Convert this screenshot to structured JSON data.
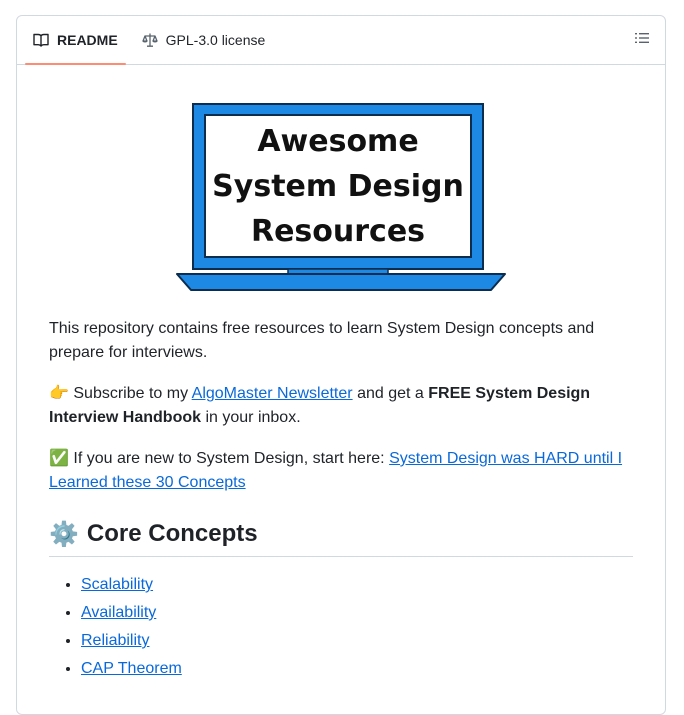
{
  "tabs": [
    {
      "label": "README",
      "icon": "book-icon",
      "active": true
    },
    {
      "label": "GPL-3.0 license",
      "icon": "law-icon",
      "active": false
    }
  ],
  "hero": {
    "line1": "Awesome",
    "line2": "System Design",
    "line3": "Resources"
  },
  "intro": "This repository contains free resources to learn System Design concepts and prepare for interviews.",
  "subscribe": {
    "emoji": "👉",
    "prefix": "Subscribe to my",
    "link": "AlgoMaster Newsletter",
    "middle": "and get a",
    "bold": "FREE System Design Interview Handbook",
    "suffix": "in your inbox."
  },
  "newcomer": {
    "emoji": "✅",
    "prefix": "If you are new to System Design, start here:",
    "link": "System Design was HARD until I Learned these 30 Concepts"
  },
  "section": {
    "emoji": "⚙️",
    "title": "Core Concepts"
  },
  "concepts": [
    "Scalability",
    "Availability",
    "Reliability",
    "CAP Theorem"
  ],
  "colors": {
    "accent": "#fd8c73",
    "link": "#0969da",
    "laptop_blue": "#1e88e5"
  }
}
